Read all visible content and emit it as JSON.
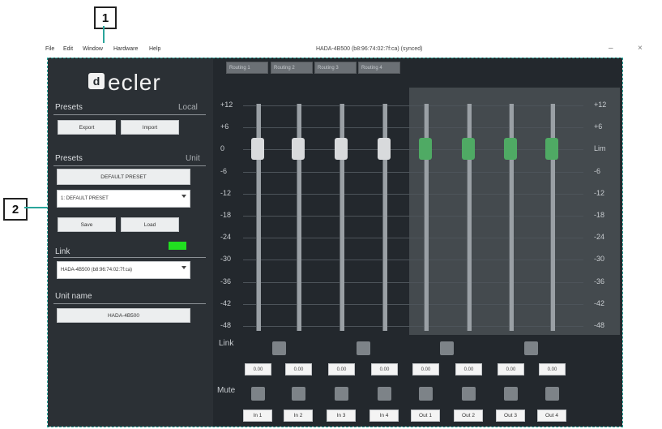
{
  "callouts": [
    "1",
    "2"
  ],
  "window": {
    "menu": [
      "File",
      "Edit",
      "Window",
      "Hardware",
      "Help"
    ],
    "title": "HADA-4B500 (b8:96:74:02:7f:ca) (synced)",
    "minimize": "–",
    "close": "×"
  },
  "logo": {
    "mark": "d",
    "text": "ecler"
  },
  "sidebar": {
    "presets_local": {
      "title": "Presets",
      "scope": "Local",
      "export": "Export",
      "import": "Import"
    },
    "presets_unit": {
      "title": "Presets",
      "scope": "Unit",
      "current": "DEFAULT PRESET",
      "selected": "1: DEFAULT PRESET",
      "save": "Save",
      "load": "Load"
    },
    "link": {
      "title": "Link",
      "device": "HADA-4B500 (b8:96:74:02:7f:ca)",
      "status_color": "#21e020"
    },
    "unit_name": {
      "title": "Unit name",
      "value": "HADA-4B500"
    }
  },
  "mixer": {
    "routing": [
      "Routing 1",
      "Routing 2",
      "Routing 3",
      "Routing 4"
    ],
    "scale_left": [
      "+12",
      "+6",
      "0",
      "-6",
      "-12",
      "-18",
      "-24",
      "-30",
      "-36",
      "-42",
      "-48"
    ],
    "scale_right": [
      "+12",
      "+6",
      "Lim",
      "-6",
      "-12",
      "-18",
      "-24",
      "-30",
      "-36",
      "-42",
      "-48"
    ],
    "link_label": "Link",
    "mute_label": "Mute",
    "values": [
      "0.00",
      "0.00",
      "0.00",
      "0.00",
      "0.00",
      "0.00",
      "0.00",
      "0.00"
    ],
    "channels": [
      "In 1",
      "In 2",
      "In 3",
      "In 4",
      "Out 1",
      "Out 2",
      "Out 3",
      "Out 4"
    ]
  }
}
